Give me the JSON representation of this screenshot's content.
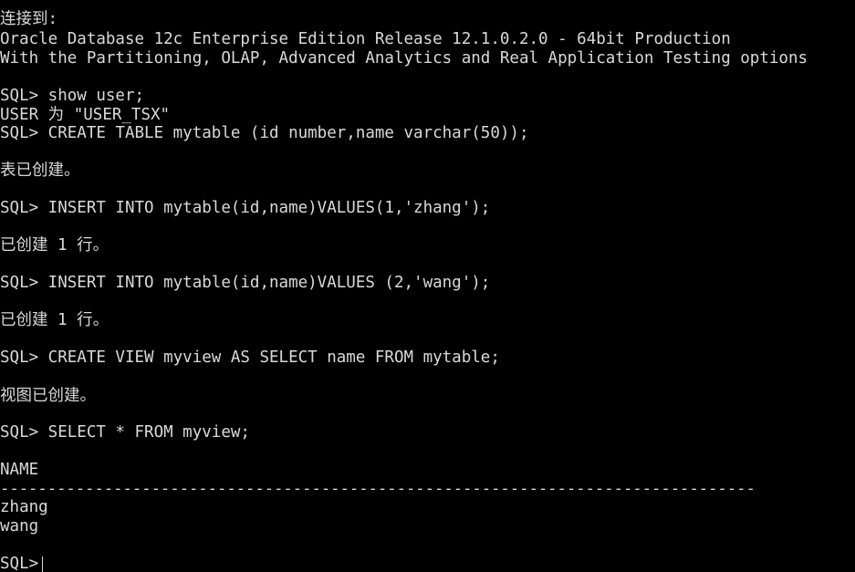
{
  "terminal": {
    "lines": [
      "连接到:",
      "Oracle Database 12c Enterprise Edition Release 12.1.0.2.0 - 64bit Production",
      "With the Partitioning, OLAP, Advanced Analytics and Real Application Testing options",
      "SQL> show user;",
      "USER 为 \"USER_TSX\"",
      "SQL> CREATE TABLE mytable (id number,name varchar(50));",
      "表已创建。",
      "SQL> INSERT INTO mytable(id,name)VALUES(1,'zhang');",
      "已创建 1 行。",
      "SQL> INSERT INTO mytable(id,name)VALUES (2,'wang');",
      "已创建 1 行。",
      "SQL> CREATE VIEW myview AS SELECT name FROM mytable;",
      "视图已创建。",
      "SQL> SELECT * FROM myview;",
      "NAME",
      "--------------------------------------------------------------------------------",
      "zhang",
      "wang"
    ],
    "prompt": "SQL>"
  },
  "colors": {
    "background": "#000000",
    "text": "#d9d9d9"
  }
}
